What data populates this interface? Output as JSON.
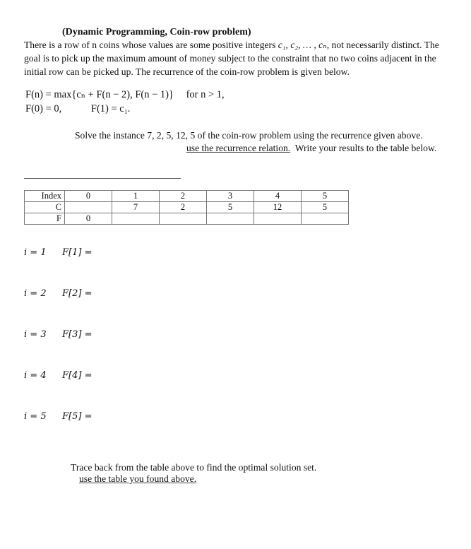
{
  "title": "(Dynamic Programming, Coin-row problem)",
  "intro": {
    "line1_pre": "There is a row of n coins whose values are some positive integers ",
    "line1_math": "c₁, c₂, … , cₙ",
    "line1_post": ", not necessarily distinct. The",
    "line2": "goal is to pick up the maximum amount of money subject to the constraint that no two coins adjacent in the",
    "line3": "initial row can be picked up. The recurrence of the coin-row problem is given below."
  },
  "recurrence": {
    "line1": "F(n) = max{cₙ + F(n − 2), F(n − 1)}",
    "line1_cond": "for n > 1,",
    "base0": "F(0) = 0,",
    "base1": "F(1) = c₁."
  },
  "instructions": {
    "line1": "Solve the instance 7, 2, 5, 12, 5 of the coin-row problem using the recurrence given above.",
    "line2_underlined": "use the recurrence relation.",
    "line2_rest": "  Write your results to the table below."
  },
  "table": {
    "rows": [
      {
        "label": "Index",
        "cells": [
          "0",
          "1",
          "2",
          "3",
          "4",
          "5"
        ]
      },
      {
        "label": "C",
        "cells": [
          "",
          "7",
          "2",
          "5",
          "12",
          "5"
        ]
      },
      {
        "label": "F",
        "cells": [
          "0",
          "",
          "",
          "",
          "",
          ""
        ]
      }
    ]
  },
  "steps": [
    {
      "i": "i = 1",
      "f": "F[1]  ="
    },
    {
      "i": "i = 2",
      "f": "F[2]  ="
    },
    {
      "i": "i = 3",
      "f": "F[3]  ="
    },
    {
      "i": "i = 4",
      "f": "F[4]  ="
    },
    {
      "i": "i = 5",
      "f": "F[5]  ="
    }
  ],
  "trace": {
    "line1": "Trace back from the table above to find the optimal solution set.",
    "line2_underlined": "use the table you found above."
  }
}
